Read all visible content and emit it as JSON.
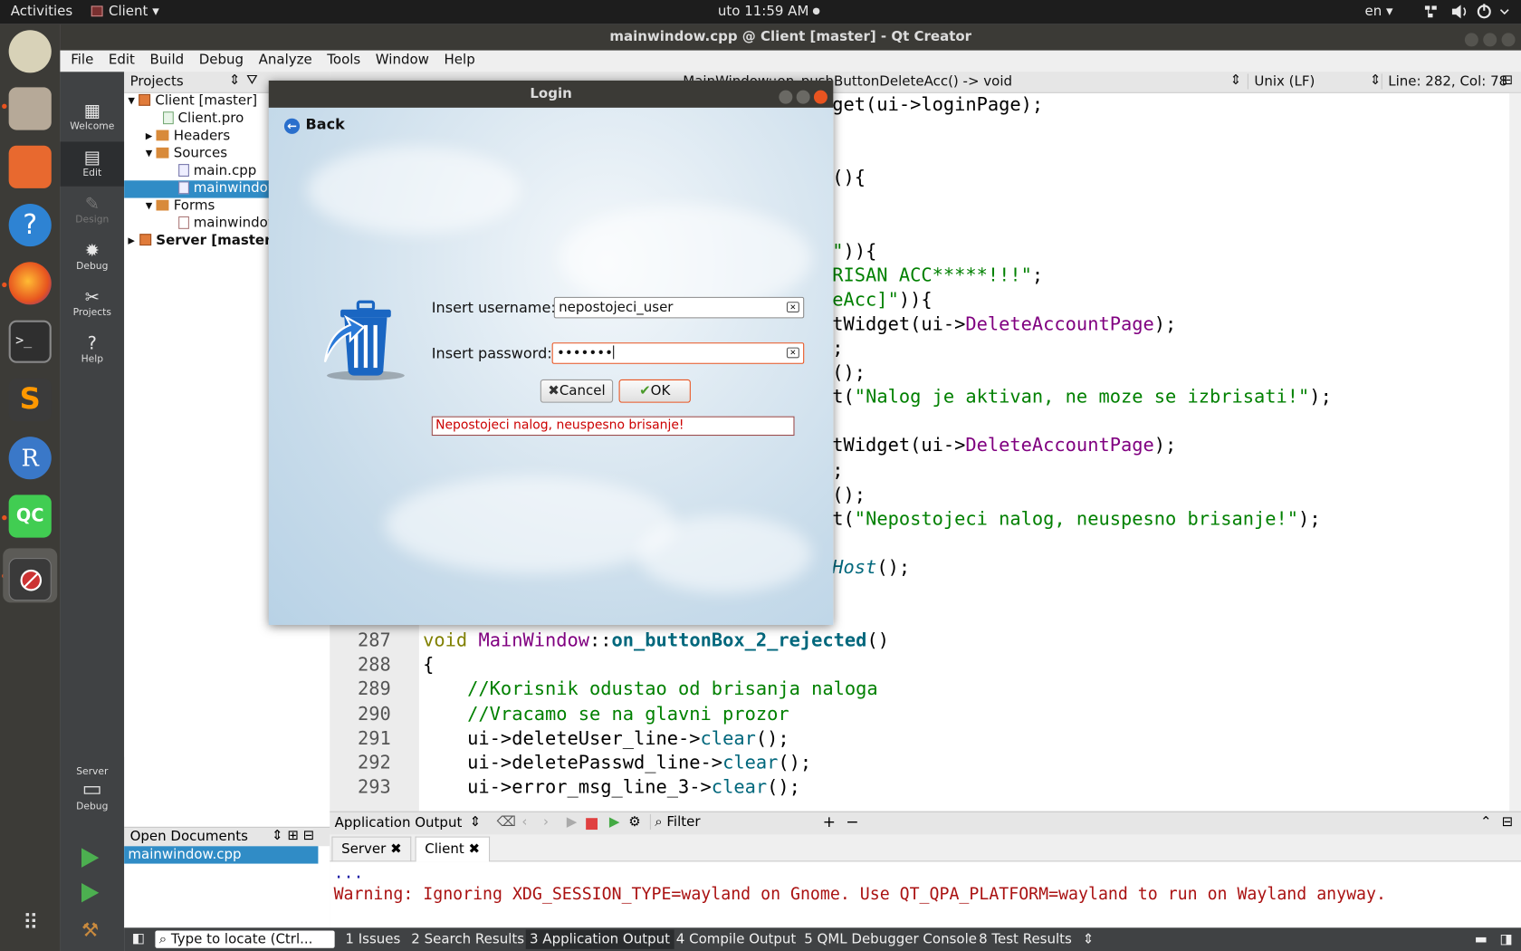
{
  "topbar": {
    "activities": "Activities",
    "app": "Client",
    "clock": "uto 11:59 AM",
    "lang": "en",
    "sys_icons": "⚿ 🔊 ⏻"
  },
  "window": {
    "title": "mainwindow.cpp @ Client [master] - Qt Creator"
  },
  "menu": [
    "File",
    "Edit",
    "Build",
    "Debug",
    "Analyze",
    "Tools",
    "Window",
    "Help"
  ],
  "modes": [
    "Welcome",
    "Edit",
    "Design",
    "Debug",
    "Projects",
    "Help"
  ],
  "kit": {
    "name": "Server",
    "mode": "Debug"
  },
  "projects": {
    "header": "Projects",
    "tree": [
      {
        "label": "Client [master]",
        "depth": 0,
        "expanded": true,
        "bold": false
      },
      {
        "label": "Client.pro",
        "depth": 1
      },
      {
        "label": "Headers",
        "depth": 1,
        "expanded": false
      },
      {
        "label": "Sources",
        "depth": 1,
        "expanded": true
      },
      {
        "label": "main.cpp",
        "depth": 2
      },
      {
        "label": "mainwindow.cpp",
        "depth": 2,
        "selected": true
      },
      {
        "label": "Forms",
        "depth": 1,
        "expanded": true
      },
      {
        "label": "mainwindow.ui",
        "depth": 2
      },
      {
        "label": "Server [master]",
        "depth": 0,
        "expanded": false,
        "bold": true
      }
    ]
  },
  "open_documents": {
    "header": "Open Documents",
    "items": [
      "mainwindow.cpp"
    ]
  },
  "editor": {
    "function": "MainWindow::on_pushButtonDeleteAcc() -> void",
    "line_ending": "Unix (LF)",
    "cursor": "Line: 282, Col: 78",
    "partial_lines": [
      {
        "text": "get(ui->loginPage);",
        "row": 0
      },
      {
        "text": "(){",
        "row": 3
      },
      {
        "text": "\")){",
        "row": 6
      },
      {
        "text": "RISAN ACC*****!!!\";",
        "row": 7
      },
      {
        "text": "eAcc]\")){",
        "row": 8
      },
      {
        "text": "tWidget(ui->DeleteAccountPage);",
        "row": 9
      },
      {
        "text": ";",
        "row": 10
      },
      {
        "text": "();",
        "row": 11
      },
      {
        "text": "t(\"Nalog je aktivan, ne moze se izbrisati!\");",
        "row": 12
      },
      {
        "text": "tWidget(ui->DeleteAccountPage);",
        "row": 14
      },
      {
        "text": ";",
        "row": 15
      },
      {
        "text": "();",
        "row": 16
      },
      {
        "text": "t(\"Nepostojeci nalog, neuspesno brisanje!\");",
        "row": 17
      },
      {
        "text": "Host();",
        "row": 19
      }
    ],
    "lines": [
      {
        "num": "287",
        "code": "void MainWindow::on_buttonBox_2_rejected()"
      },
      {
        "num": "288",
        "code": "{"
      },
      {
        "num": "289",
        "code": "    //Korisnik odustao od brisanja naloga"
      },
      {
        "num": "290",
        "code": "    //Vracamo se na glavni prozor"
      },
      {
        "num": "291",
        "code": "    ui->deleteUser_line->clear();"
      },
      {
        "num": "292",
        "code": "    ui->deletePasswd_line->clear();"
      },
      {
        "num": "293",
        "code": "    ui->error_msg_line_3->clear();"
      }
    ]
  },
  "output": {
    "title": "Application Output",
    "filter_placeholder": "Filter",
    "tabs": [
      "Server",
      "Client"
    ],
    "active_tab": "Client",
    "lines": [
      "...",
      "Warning: Ignoring XDG_SESSION_TYPE=wayland on Gnome. Use QT_QPA_PLATFORM=wayland to run on Wayland anyway."
    ]
  },
  "statusbar": {
    "locate_placeholder": "Type to locate (Ctrl...",
    "panes": [
      "1  Issues",
      "2  Search Results",
      "3  Application Output",
      "4  Compile Output",
      "5  QML Debugger Console",
      "8  Test Results"
    ]
  },
  "login": {
    "title": "Login",
    "back": "Back",
    "username_label": "Insert username:",
    "username_value": "nepostojeci_user",
    "password_label": "Insert password:",
    "password_value": "•••••••",
    "cancel": "Cancel",
    "ok": "OK",
    "error": "Nepostojeci nalog, neuspesno brisanje!"
  },
  "colors": {
    "accent": "#e95420",
    "selection": "#308cc6",
    "error": "#cc0000"
  }
}
